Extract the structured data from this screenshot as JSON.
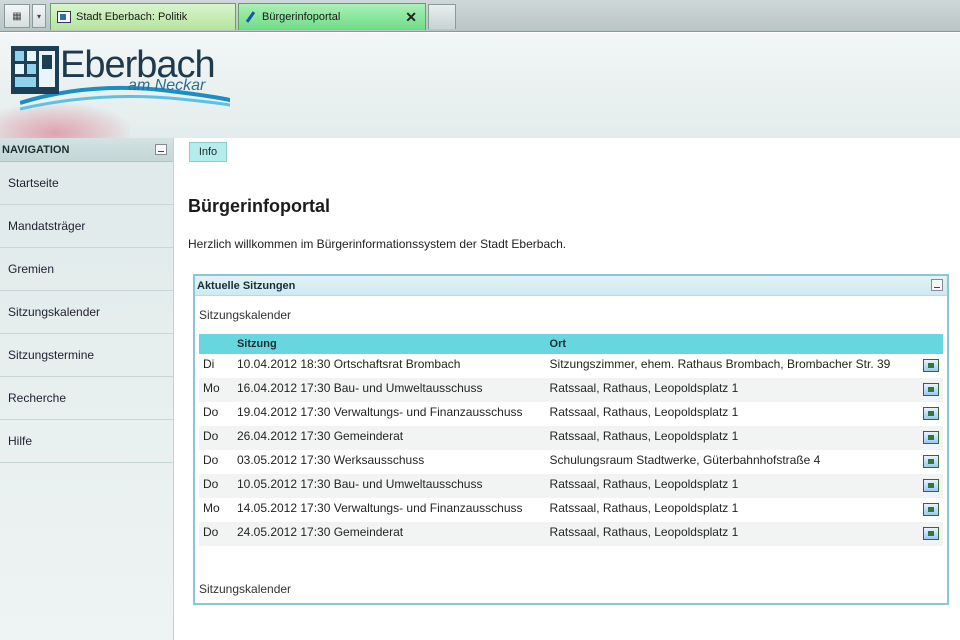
{
  "browser": {
    "tabs": [
      {
        "label": "Stadt Eberbach: Politik",
        "active": false
      },
      {
        "label": "Bürgerinfoportal",
        "active": true
      }
    ],
    "close_glyph": "✕",
    "grid_glyph": "▦",
    "menu_glyph": "▾"
  },
  "header": {
    "logo_main": "Eberbach",
    "logo_sub": "am Neckar"
  },
  "nav": {
    "title": "NAVIGATION",
    "items": [
      "Startseite",
      "Mandatsträger",
      "Gremien",
      "Sitzungskalender",
      "Sitzungstermine",
      "Recherche",
      "Hilfe"
    ]
  },
  "main": {
    "tab_label": "Info",
    "title": "Bürgerinfoportal",
    "welcome": "Herzlich willkommen im Bürgerinformationssystem der Stadt Eberbach.",
    "panel": {
      "title": "Aktuelle Sitzungen",
      "calendar_link_top": "Sitzungskalender",
      "calendar_link_bottom": "Sitzungskalender",
      "columns": [
        "Sitzung",
        "Ort"
      ],
      "rows": [
        {
          "day": "Di",
          "session": "10.04.2012 18:30 Ortschaftsrat Brombach",
          "place": "Sitzungszimmer, ehem. Rathaus Brombach, Brombacher Str. 39"
        },
        {
          "day": "Mo",
          "session": "16.04.2012 17:30 Bau- und Umweltausschuss",
          "place": "Ratssaal, Rathaus, Leopoldsplatz 1"
        },
        {
          "day": "Do",
          "session": "19.04.2012 17:30 Verwaltungs- und Finanzausschuss",
          "place": "Ratssaal, Rathaus, Leopoldsplatz 1"
        },
        {
          "day": "Do",
          "session": "26.04.2012 17:30 Gemeinderat",
          "place": "Ratssaal, Rathaus, Leopoldsplatz 1"
        },
        {
          "day": "Do",
          "session": "03.05.2012 17:30 Werksausschuss",
          "place": "Schulungsraum Stadtwerke, Güterbahnhofstraße 4"
        },
        {
          "day": "Do",
          "session": "10.05.2012 17:30 Bau- und Umweltausschuss",
          "place": "Ratssaal, Rathaus, Leopoldsplatz 1"
        },
        {
          "day": "Mo",
          "session": "14.05.2012 17:30 Verwaltungs- und Finanzausschuss",
          "place": "Ratssaal, Rathaus, Leopoldsplatz 1"
        },
        {
          "day": "Do",
          "session": "24.05.2012 17:30 Gemeinderat",
          "place": "Ratssaal, Rathaus, Leopoldsplatz 1"
        }
      ]
    }
  },
  "colors": {
    "table_header": "#67d6df",
    "panel_border": "#8cc6d6",
    "active_tab": "#6fdc85"
  }
}
